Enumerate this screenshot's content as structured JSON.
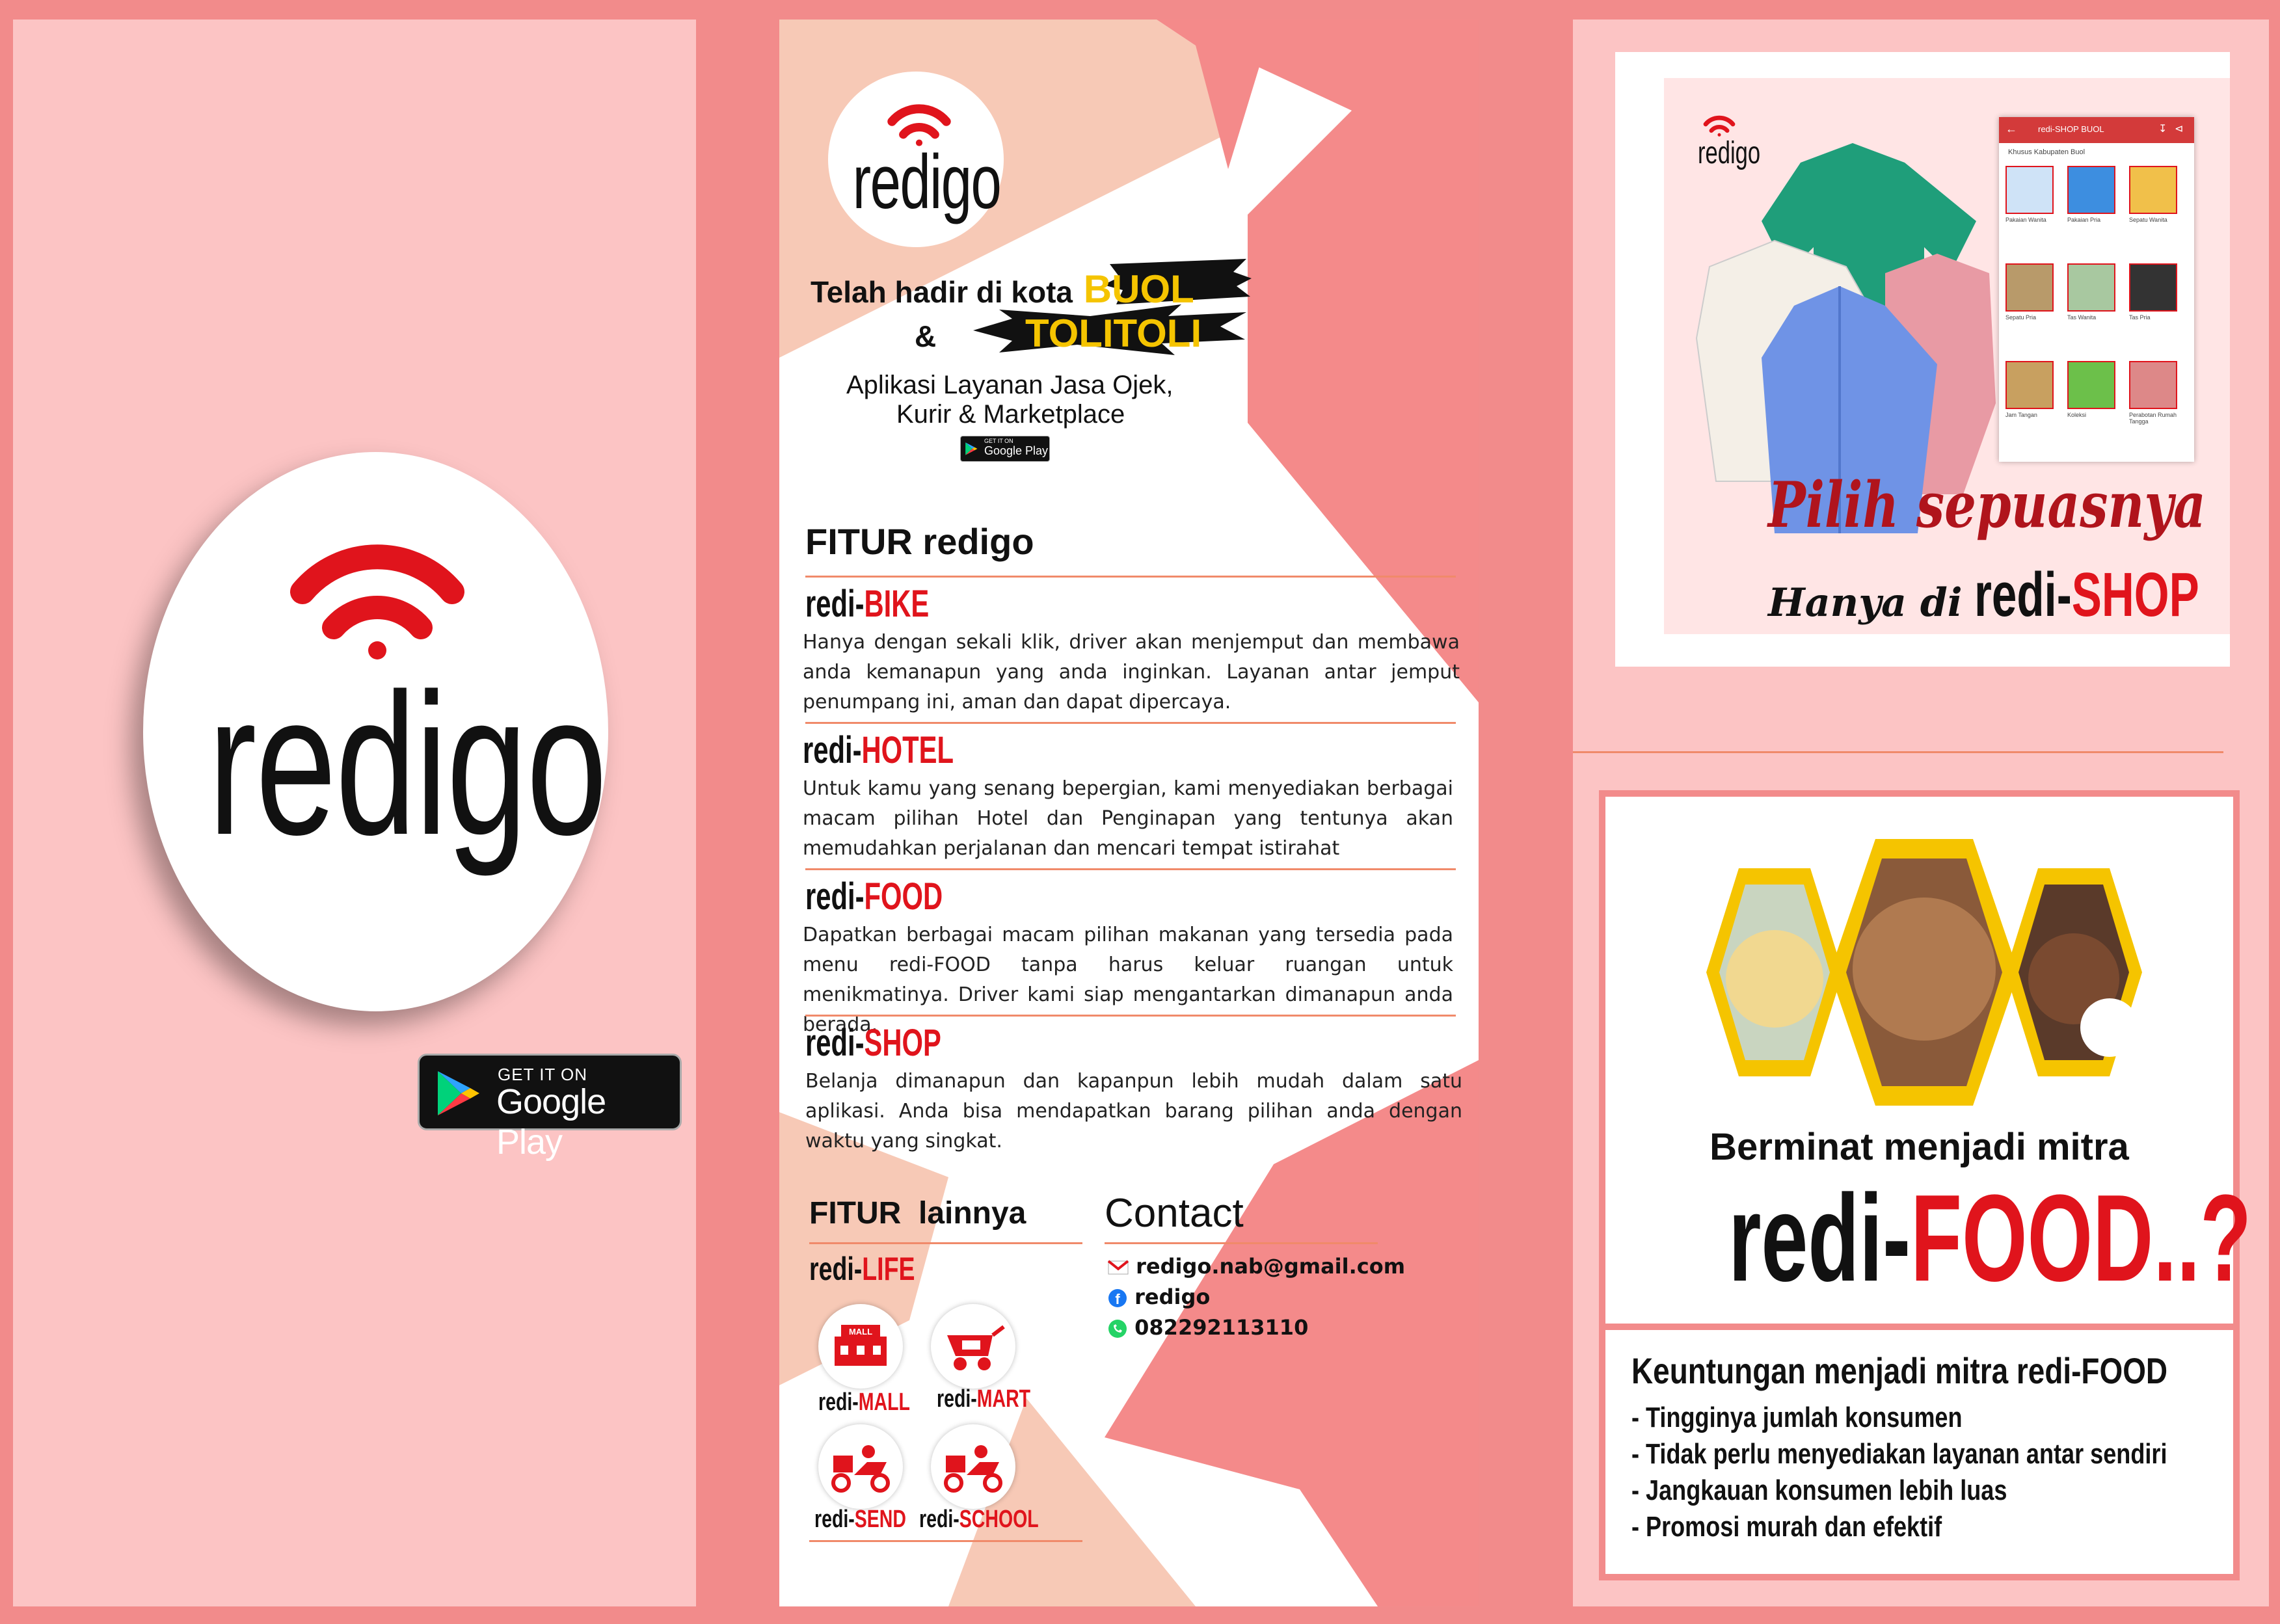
{
  "colors": {
    "accent": "#e0141c",
    "background": "#f28b8b",
    "panel": "#fcc4c4",
    "line": "#f08a6a",
    "yellow": "#f5c400"
  },
  "cover": {
    "logo_text": "redigo",
    "badge_small": "GET IT ON",
    "badge_big": "Google Play"
  },
  "middle": {
    "logo_text": "redigo",
    "headline_prefix": "Telah hadir di kota",
    "city1": "BUOL",
    "amp": "&",
    "city2": "TOLITOLI",
    "tagline_line1": "Aplikasi Layanan Jasa Ojek,",
    "tagline_line2": "Kurir & Marketplace",
    "badge_small": "GET IT ON",
    "badge_big": "Google Play",
    "features_heading": "FITUR redigo",
    "features": [
      {
        "prefix": "redi-",
        "name": "BIKE",
        "desc": "Hanya dengan sekali klik, driver akan menjemput dan membawa anda kemanapun yang anda inginkan. Layanan antar jemput penumpang ini, aman dan dapat dipercaya."
      },
      {
        "prefix": "redi-",
        "name": "HOTEL",
        "desc": "Untuk kamu yang senang bepergian, kami menyediakan berbagai macam pilihan Hotel dan Penginapan yang tentunya akan memudahkan perjalanan dan mencari tempat istirahat"
      },
      {
        "prefix": "redi-",
        "name": "FOOD",
        "desc": "Dapatkan berbagai macam pilihan makanan yang tersedia pada menu redi-FOOD tanpa harus keluar ruangan untuk menikmatinya. Driver kami siap mengantarkan dimanapun anda berada."
      },
      {
        "prefix": "redi-",
        "name": "SHOP",
        "desc": "Belanja dimanapun dan kapanpun lebih mudah dalam satu aplikasi. Anda bisa mendapatkan barang pilihan anda dengan  waktu yang singkat."
      }
    ],
    "other_heading": "FITUR  lainnya",
    "life": {
      "prefix": "redi-",
      "name": "LIFE"
    },
    "other_items": [
      {
        "prefix": "redi-",
        "name": "MALL",
        "icon": "mall-icon"
      },
      {
        "prefix": "redi-",
        "name": "MART",
        "icon": "cart-icon"
      },
      {
        "prefix": "redi-",
        "name": "SEND",
        "icon": "scooter-icon"
      },
      {
        "prefix": "redi-",
        "name": "SCHOOL",
        "icon": "scooter-icon"
      }
    ],
    "mall_sign": "MALL",
    "contact_heading": "Contact",
    "contacts": [
      {
        "icon": "gmail-icon",
        "text": "redigo.nab@gmail.com"
      },
      {
        "icon": "facebook-icon",
        "text": "redigo"
      },
      {
        "icon": "whatsapp-icon",
        "text": "082292113110"
      }
    ]
  },
  "shop_ad": {
    "logo_text": "redigo",
    "app_bar_title": "redi-SHOP BUOL",
    "subtitle": "Khusus Kabupaten Buol",
    "categories": [
      "Pakaian Wanita",
      "Pakaian Pria",
      "Sepatu Wanita",
      "Sepatu Pria",
      "Tas Wanita",
      "Tas Pria",
      "Jam Tangan",
      "Koleksi",
      "Perabotan Rumah Tangga"
    ],
    "slogan1": "Pilih sepuasnya",
    "slogan2_prefix": "Hanya di",
    "slogan2_brand_prefix": "redi-",
    "slogan2_brand_name": "SHOP"
  },
  "food_ad": {
    "question": "Berminat menjadi mitra",
    "brand_prefix": "redi-",
    "brand_name": "FOOD..?",
    "benefits_heading": "Keuntungan menjadi mitra redi-FOOD",
    "benefits": [
      "- Tingginya jumlah konsumen",
      "- Tidak perlu menyediakan layanan antar sendiri",
      "- Jangkauan konsumen lebih luas",
      "- Promosi murah dan efektif"
    ]
  }
}
